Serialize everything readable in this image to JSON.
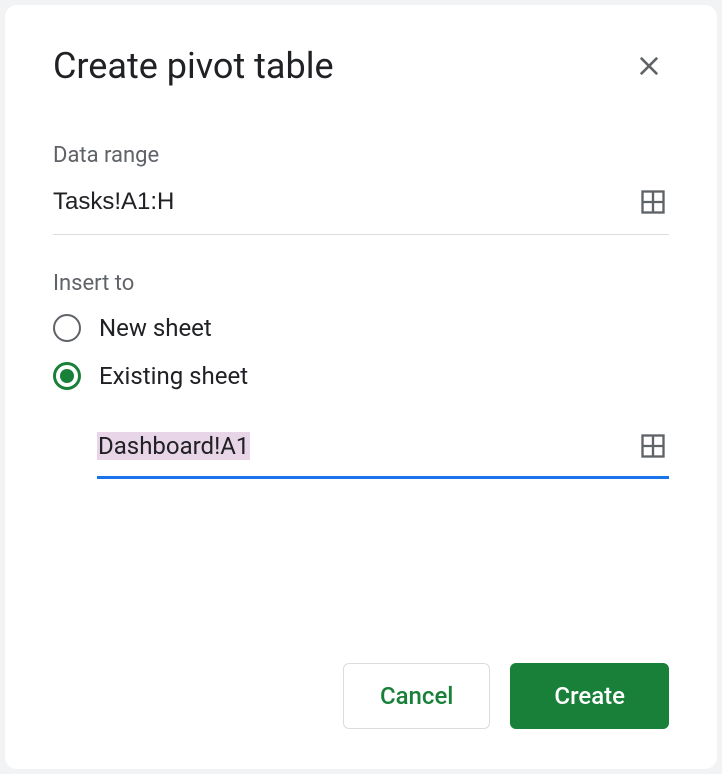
{
  "dialog": {
    "title": "Create pivot table",
    "data_range": {
      "label": "Data range",
      "value": "Tasks!A1:H"
    },
    "insert_to": {
      "label": "Insert to",
      "options": {
        "new_sheet": "New sheet",
        "existing_sheet": "Existing sheet"
      },
      "selected": "existing_sheet",
      "existing_sheet_value": "Dashboard!A1"
    },
    "buttons": {
      "cancel": "Cancel",
      "create": "Create"
    }
  }
}
